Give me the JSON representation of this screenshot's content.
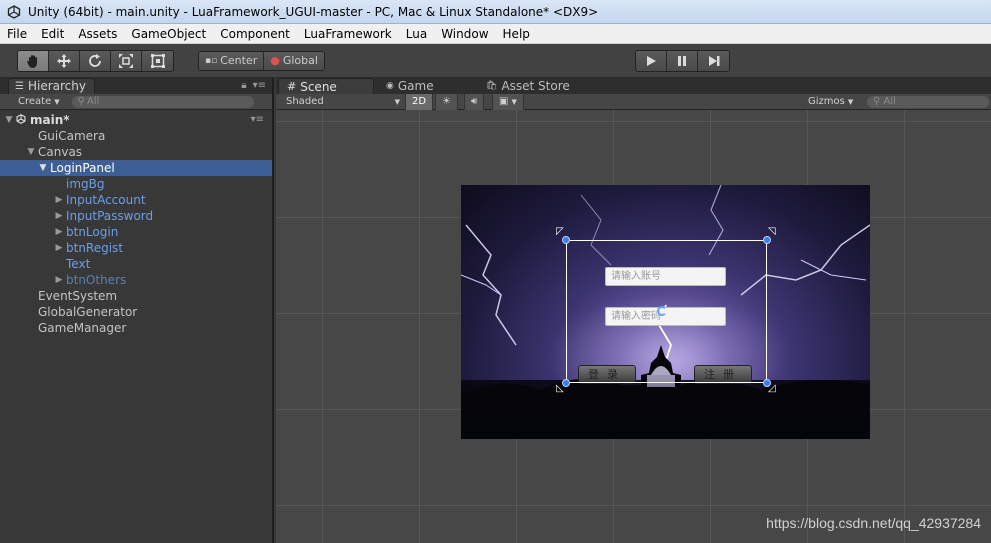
{
  "window": {
    "title": "Unity (64bit) - main.unity - LuaFramework_UGUI-master - PC, Mac & Linux Standalone* <DX9>"
  },
  "menu": [
    "File",
    "Edit",
    "Assets",
    "GameObject",
    "Component",
    "LuaFramework",
    "Lua",
    "Window",
    "Help"
  ],
  "toolbar": {
    "transform_tools": [
      "hand-icon",
      "move-icon",
      "rotate-icon",
      "scale-icon",
      "rect-icon"
    ],
    "pivot": {
      "center_label": "Center",
      "global_label": "Global"
    },
    "playback": [
      "play-icon",
      "pause-icon",
      "step-icon"
    ]
  },
  "hierarchy": {
    "tab_label": "Hierarchy",
    "create_label": "Create",
    "search_placeholder": "All",
    "scene_name": "main*",
    "items": [
      {
        "label": "GuiCamera"
      },
      {
        "label": "Canvas"
      },
      {
        "label": "LoginPanel"
      },
      {
        "label": "imgBg"
      },
      {
        "label": "InputAccount"
      },
      {
        "label": "InputPassword"
      },
      {
        "label": "btnLogin"
      },
      {
        "label": "btnRegist"
      },
      {
        "label": "Text"
      },
      {
        "label": "btnOthers"
      },
      {
        "label": "EventSystem"
      },
      {
        "label": "GlobalGenerator"
      },
      {
        "label": "GameManager"
      }
    ]
  },
  "scene": {
    "tabs": [
      {
        "label": "Scene"
      },
      {
        "label": "Game"
      },
      {
        "label": "Asset Store"
      }
    ],
    "shading_mode": "Shaded",
    "mode_2d_label": "2D",
    "gizmos_label": "Gizmos",
    "search_placeholder": "All",
    "login": {
      "account_placeholder": "请输入账号",
      "password_placeholder": "请输入密码",
      "login_label": "登录",
      "register_label": "注册"
    },
    "watermark": "https://blog.csdn.net/qq_42937284"
  }
}
